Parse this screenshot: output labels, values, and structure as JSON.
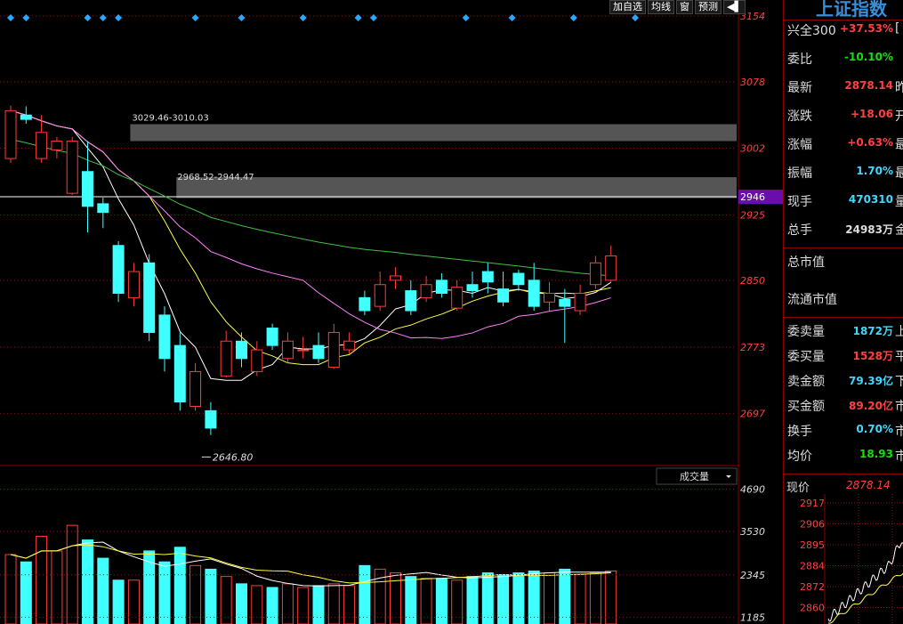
{
  "toolbar": {
    "add_label": "加自选",
    "ma_label": "均线",
    "window_label": "窗",
    "forecast_label": "预测"
  },
  "signals": [
    0,
    1,
    5,
    6,
    7,
    12,
    15,
    19,
    22,
    23,
    29,
    32,
    36,
    40
  ],
  "price_axis": {
    "ticks": [
      "3154",
      "3078",
      "3002",
      "2925",
      "2850",
      "2773",
      "2697"
    ],
    "current_tag": "2946"
  },
  "vol_axis": {
    "ticks": [
      "4690",
      "3530",
      "2345",
      "1185"
    ]
  },
  "annotations": {
    "gap1": "3029.46-3010.03",
    "gap2": "2968.52-2944.47",
    "low": "2646.80"
  },
  "volume_label": "成交量",
  "colors": {
    "up": "#ff3b3b",
    "down": "#40ffff",
    "ma5": "#ffffff",
    "ma10": "#ffff40",
    "ma20": "#ff80ff",
    "ma60": "#40c040",
    "gap": "#555555"
  },
  "chart_data": {
    "type": "candlestick",
    "y_range": [
      2640,
      3160
    ],
    "volume_range": [
      1000,
      4800
    ],
    "candles": [
      {
        "o": 2990,
        "c": 3045,
        "h": 3051,
        "l": 2985,
        "v": 2900
      },
      {
        "o": 3040,
        "c": 3035,
        "h": 3050,
        "l": 3030,
        "v": 2700
      },
      {
        "o": 2990,
        "c": 3020,
        "h": 3040,
        "l": 2985,
        "v": 3400
      },
      {
        "o": 3000,
        "c": 3010,
        "h": 3015,
        "l": 2990,
        "v": 3000
      },
      {
        "o": 2950,
        "c": 3010,
        "h": 3015,
        "l": 2948,
        "v": 3700
      },
      {
        "o": 2975,
        "c": 2935,
        "h": 3010,
        "l": 2905,
        "v": 3300
      },
      {
        "o": 2938,
        "c": 2928,
        "h": 2945,
        "l": 2910,
        "v": 2800
      },
      {
        "o": 2890,
        "c": 2835,
        "h": 2895,
        "l": 2825,
        "v": 2200
      },
      {
        "o": 2830,
        "c": 2860,
        "h": 2870,
        "l": 2820,
        "v": 2200
      },
      {
        "o": 2870,
        "c": 2790,
        "h": 2880,
        "l": 2780,
        "v": 3000
      },
      {
        "o": 2810,
        "c": 2760,
        "h": 2820,
        "l": 2745,
        "v": 2700
      },
      {
        "o": 2775,
        "c": 2710,
        "h": 2790,
        "l": 2700,
        "v": 3100
      },
      {
        "o": 2705,
        "c": 2745,
        "h": 2755,
        "l": 2700,
        "v": 2600
      },
      {
        "o": 2700,
        "c": 2680,
        "h": 2710,
        "l": 2672,
        "v": 2500
      },
      {
        "o": 2740,
        "c": 2780,
        "h": 2792,
        "l": 2738,
        "v": 2300
      },
      {
        "o": 2780,
        "c": 2760,
        "h": 2790,
        "l": 2750,
        "v": 2100
      },
      {
        "o": 2745,
        "c": 2770,
        "h": 2780,
        "l": 2740,
        "v": 2050
      },
      {
        "o": 2795,
        "c": 2775,
        "h": 2800,
        "l": 2770,
        "v": 2000
      },
      {
        "o": 2760,
        "c": 2780,
        "h": 2790,
        "l": 2755,
        "v": 2100
      },
      {
        "o": 2770,
        "c": 2770,
        "h": 2785,
        "l": 2760,
        "v": 2000
      },
      {
        "o": 2775,
        "c": 2760,
        "h": 2790,
        "l": 2755,
        "v": 2050
      },
      {
        "o": 2750,
        "c": 2790,
        "h": 2800,
        "l": 2748,
        "v": 2100
      },
      {
        "o": 2770,
        "c": 2780,
        "h": 2790,
        "l": 2765,
        "v": 2050
      },
      {
        "o": 2830,
        "c": 2815,
        "h": 2838,
        "l": 2810,
        "v": 2600
      },
      {
        "o": 2820,
        "c": 2845,
        "h": 2860,
        "l": 2815,
        "v": 2500
      },
      {
        "o": 2850,
        "c": 2855,
        "h": 2865,
        "l": 2840,
        "v": 2400
      },
      {
        "o": 2838,
        "c": 2815,
        "h": 2850,
        "l": 2810,
        "v": 2300
      },
      {
        "o": 2830,
        "c": 2845,
        "h": 2855,
        "l": 2825,
        "v": 2250
      },
      {
        "o": 2850,
        "c": 2835,
        "h": 2858,
        "l": 2830,
        "v": 2250
      },
      {
        "o": 2818,
        "c": 2842,
        "h": 2850,
        "l": 2815,
        "v": 2200
      },
      {
        "o": 2845,
        "c": 2838,
        "h": 2860,
        "l": 2830,
        "v": 2300
      },
      {
        "o": 2860,
        "c": 2848,
        "h": 2870,
        "l": 2835,
        "v": 2400
      },
      {
        "o": 2840,
        "c": 2825,
        "h": 2860,
        "l": 2820,
        "v": 2350
      },
      {
        "o": 2858,
        "c": 2845,
        "h": 2862,
        "l": 2838,
        "v": 2400
      },
      {
        "o": 2850,
        "c": 2820,
        "h": 2870,
        "l": 2815,
        "v": 2450
      },
      {
        "o": 2825,
        "c": 2835,
        "h": 2848,
        "l": 2815,
        "v": 2400
      },
      {
        "o": 2828,
        "c": 2820,
        "h": 2840,
        "l": 2778,
        "v": 2500
      },
      {
        "o": 2815,
        "c": 2835,
        "h": 2845,
        "l": 2810,
        "v": 2350
      },
      {
        "o": 2845,
        "c": 2870,
        "h": 2878,
        "l": 2840,
        "v": 2400
      },
      {
        "o": 2850,
        "c": 2878,
        "h": 2890,
        "l": 2848,
        "v": 2450
      }
    ]
  },
  "panel": {
    "title": "上证指数",
    "rows": [
      {
        "label": "兴全300",
        "value": "+37.53%",
        "cls": "red",
        "tail": "["
      },
      {
        "label": "委比",
        "value": "-10.10%",
        "cls": "grn",
        "tail": ""
      },
      {
        "label": "最新",
        "value": "2878.14",
        "cls": "red",
        "tail": "昨"
      },
      {
        "label": "涨跌",
        "value": "+18.06",
        "cls": "red",
        "tail": "开"
      },
      {
        "label": "涨幅",
        "value": "+0.63%",
        "cls": "red",
        "tail": "最"
      },
      {
        "label": "振幅",
        "value": "1.70%",
        "cls": "cyn",
        "tail": "最"
      },
      {
        "label": "现手",
        "value": "470310",
        "cls": "cyn",
        "tail": "量"
      },
      {
        "label": "总手",
        "value": "24983万",
        "cls": "wht",
        "tail": "金"
      },
      {
        "label": "总市值",
        "value": "",
        "cls": "",
        "tail": ""
      },
      {
        "label": "流通市值",
        "value": "",
        "cls": "",
        "tail": ""
      },
      {
        "label": "委卖量",
        "value": "1872万",
        "cls": "cyn",
        "tail": "上"
      },
      {
        "label": "委买量",
        "value": "1528万",
        "cls": "red",
        "tail": "平"
      },
      {
        "label": "卖金额",
        "value": "79.39亿",
        "cls": "cyn",
        "tail": "下"
      },
      {
        "label": "买金额",
        "value": "89.20亿",
        "cls": "red",
        "tail": "市"
      },
      {
        "label": "换手",
        "value": "0.70%",
        "cls": "cyn",
        "tail": "市"
      },
      {
        "label": "均价",
        "value": "18.93",
        "cls": "grn",
        "tail": "市"
      }
    ],
    "current_label": "现价",
    "current_value": "2878.14",
    "mini_ticks": [
      "2917",
      "2906",
      "2895",
      "2884",
      "2872",
      "2860"
    ]
  }
}
